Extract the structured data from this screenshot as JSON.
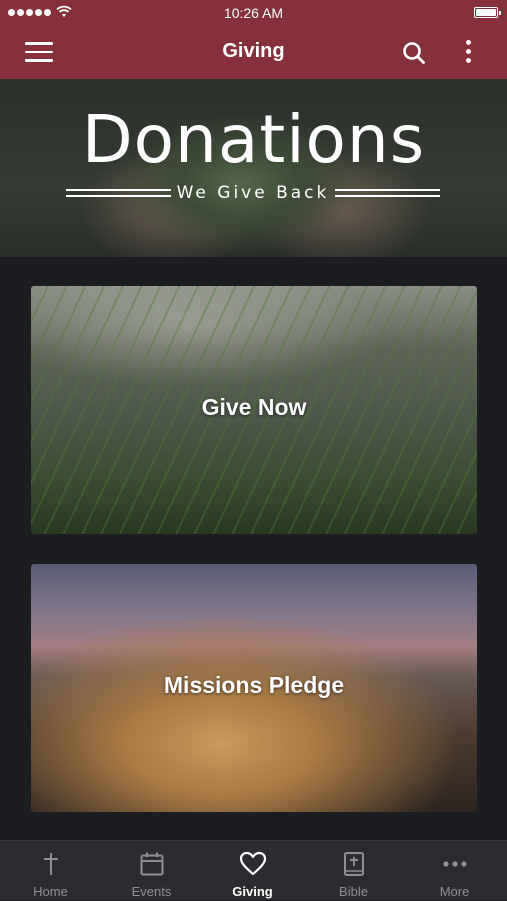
{
  "status_bar": {
    "time": "10:26 AM",
    "signal_icon": "signal-dots-icon",
    "wifi_icon": "wifi-icon",
    "battery_icon": "battery-icon",
    "battery_level": 1.0
  },
  "header": {
    "title": "Giving",
    "menu_icon": "hamburger-menu-icon",
    "search_icon": "search-icon",
    "more_icon": "more-vertical-icon",
    "background_color": "#85303a"
  },
  "banner": {
    "title": "Donations",
    "subtitle": "We Give Back"
  },
  "cards": [
    {
      "label": "Give Now"
    },
    {
      "label": "Missions Pledge"
    }
  ],
  "tab_bar": {
    "active": "Giving",
    "tabs": [
      {
        "label": "Home",
        "icon": "cross-icon"
      },
      {
        "label": "Events",
        "icon": "calendar-icon"
      },
      {
        "label": "Giving",
        "icon": "heart-icon"
      },
      {
        "label": "Bible",
        "icon": "bible-icon"
      },
      {
        "label": "More",
        "icon": "more-horizontal-icon"
      }
    ]
  },
  "colors": {
    "brand": "#85303a",
    "background": "#1c1d20",
    "tab_bar": "#2b2c2f",
    "tab_inactive": "#8e8f93",
    "tab_active": "#ffffff"
  }
}
